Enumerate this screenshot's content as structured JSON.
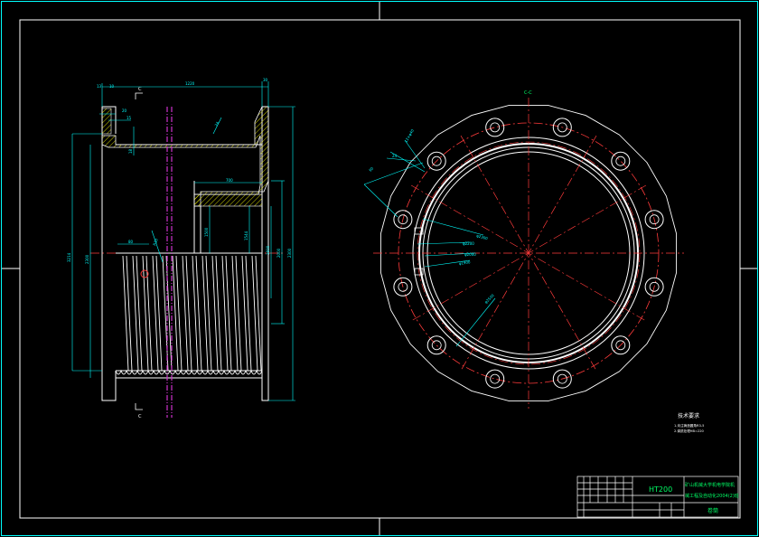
{
  "drawing": {
    "section_label_left_top": "C",
    "section_label_left_bottom": "C",
    "section_view_label": "C-C",
    "dimensions": {
      "d_overall_length": "1220",
      "d_flange_small": "30",
      "d_10": "10",
      "d_30b": "30",
      "d_left_top": "13",
      "d_20": "20",
      "d_15": "15",
      "d_18": "18",
      "d_24": "24",
      "d_ring": "700",
      "d_1200": "1200",
      "d_1500": "1500",
      "d_1544": "1544",
      "d_1600": "1600",
      "d_2000": "2000",
      "d_2300": "2300",
      "d_3214": "3214",
      "d_groove": "65",
      "d_radius": "R30",
      "c_80": "80",
      "c_60": "60",
      "c_24": "24",
      "c_bolt": "12×φ40",
      "c_d2": "φ2300",
      "c_d3": "φ2200",
      "c_d4": "φ2000",
      "c_d5": "φ1900",
      "c_d6": "φ2500"
    }
  },
  "notes": {
    "title": "技术要求",
    "line1": "1.未注铸造圆角R3-5",
    "line2": "2.调质处理HB=220"
  },
  "title_block": {
    "material": "HT200",
    "company_line1": "矿山机械大学机电学院机",
    "company_line2": "械工程及自动化2004(2)班",
    "part_name": "卷筒"
  },
  "colors": {
    "background": "#000000",
    "frame": "#00ffff",
    "outline": "#ffffff",
    "dimension": "#00ffff",
    "centerline": "#ff3b3b",
    "hatch": "#ffff00",
    "section_mark": "#cc33cc",
    "titleblock_text": "#00ff66"
  }
}
